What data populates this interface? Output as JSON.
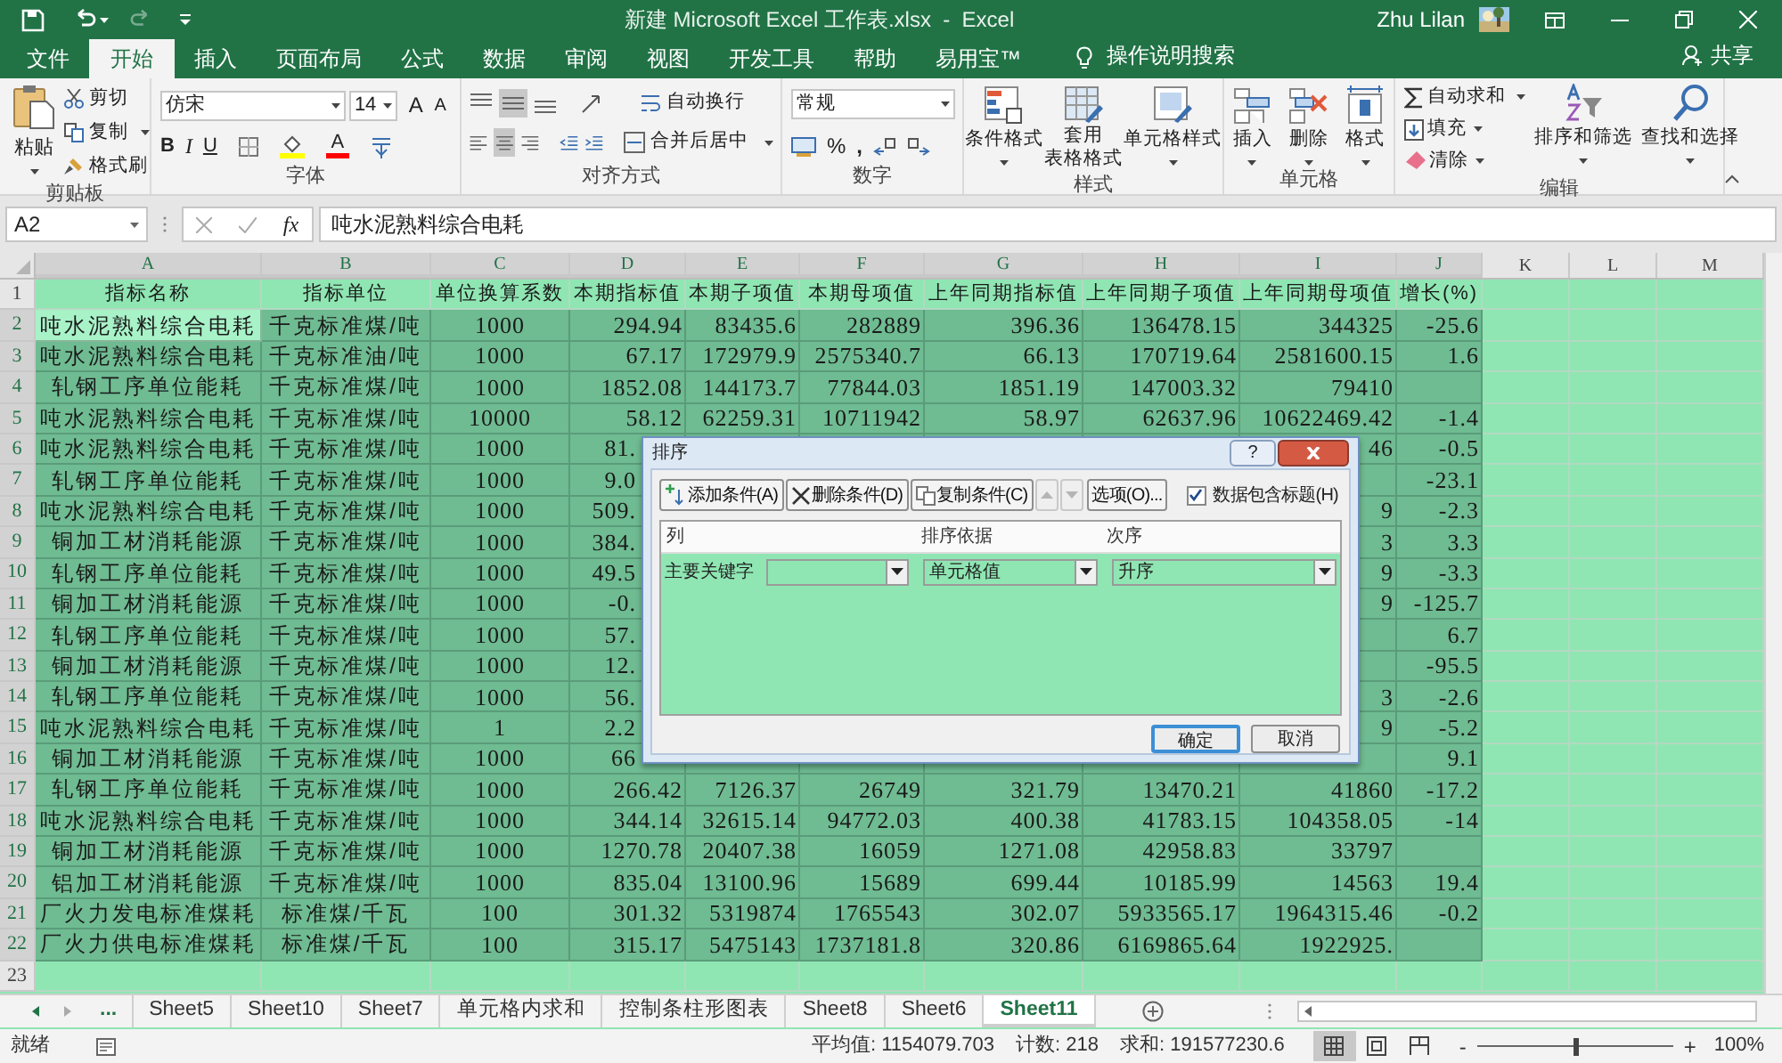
{
  "title_bar": {
    "title": "新建 Microsoft Excel 工作表.xlsx  -  Excel",
    "user": "Zhu Lilan"
  },
  "menu_tabs": [
    {
      "label": "文件",
      "selected": false
    },
    {
      "label": "开始",
      "selected": true
    },
    {
      "label": "插入",
      "selected": false
    },
    {
      "label": "页面布局",
      "selected": false
    },
    {
      "label": "公式",
      "selected": false
    },
    {
      "label": "数据",
      "selected": false
    },
    {
      "label": "审阅",
      "selected": false
    },
    {
      "label": "视图",
      "selected": false
    },
    {
      "label": "开发工具",
      "selected": false
    },
    {
      "label": "帮助",
      "selected": false
    },
    {
      "label": "易用宝™",
      "selected": false
    }
  ],
  "tell_me": "操作说明搜索",
  "share": "共享",
  "ribbon": {
    "clipboard": {
      "label": "剪贴板",
      "paste": "粘贴",
      "cut": "剪切",
      "copy": "复制",
      "format_painter": "格式刷"
    },
    "font": {
      "label": "字体",
      "font_name": "仿宋",
      "font_size": "14",
      "grow": "A",
      "shrink": "A",
      "bold": "B",
      "italic": "I",
      "underline": "U",
      "font_color": "A"
    },
    "alignment": {
      "label": "对齐方式",
      "wrap_text": "自动换行",
      "merge_center": "合并后居中"
    },
    "number": {
      "label": "数字",
      "format": "常规",
      "percent": "%",
      "comma": ","
    },
    "styles": {
      "label": "样式",
      "conditional": "条件格式",
      "table_format": [
        "套用",
        "表格格式"
      ],
      "cell_styles": "单元格样式"
    },
    "cells": {
      "label": "单元格",
      "insert": "插入",
      "delete": "删除",
      "format": "格式"
    },
    "editing": {
      "label": "编辑",
      "autosum": "自动求和",
      "fill": "填充",
      "clear": "清除",
      "sort_filter": "排序和筛选",
      "find_select": "查找和选择"
    }
  },
  "formula_bar": {
    "name_box": "A2",
    "fx": "fx",
    "content": "吨水泥熟料综合电耗"
  },
  "grid": {
    "columns": [
      {
        "label": "A",
        "selected": true
      },
      {
        "label": "B",
        "selected": true
      },
      {
        "label": "C",
        "selected": true
      },
      {
        "label": "D",
        "selected": true
      },
      {
        "label": "E",
        "selected": true
      },
      {
        "label": "F",
        "selected": true
      },
      {
        "label": "G",
        "selected": true
      },
      {
        "label": "H",
        "selected": true
      },
      {
        "label": "I",
        "selected": true
      },
      {
        "label": "J",
        "selected": true
      },
      {
        "label": "K",
        "selected": false
      },
      {
        "label": "L",
        "selected": false
      },
      {
        "label": "M",
        "selected": false
      }
    ],
    "rows": [
      {
        "number": "1",
        "selected": false,
        "active": false,
        "cells": {
          "A": "指标名称",
          "B": "指标单位",
          "C": "单位换算系数",
          "D": "本期指标值",
          "E": "本期子项值",
          "F": "本期母项值",
          "G": "上年同期指标值",
          "H": "上年同期子项值",
          "I": "上年同期母项值",
          "J": "增长(%)"
        }
      },
      {
        "number": "2",
        "selected": true,
        "active": true,
        "cells": {
          "A": "吨水泥熟料综合电耗",
          "B": "千克标准煤/吨",
          "C": "1000",
          "D": "294.94",
          "E": "83435.6",
          "F": "282889",
          "G": "396.36",
          "H": "136478.15",
          "I": "344325",
          "J": "-25.6"
        }
      },
      {
        "number": "3",
        "selected": true,
        "active": false,
        "cells": {
          "A": "吨水泥熟料综合电耗",
          "B": "千克标准油/吨",
          "C": "1000",
          "D": "67.17",
          "E": "172979.9",
          "F": "2575340.7",
          "G": "66.13",
          "H": "170719.64",
          "I": "2581600.15",
          "J": "1.6"
        }
      },
      {
        "number": "4",
        "selected": true,
        "active": false,
        "cells": {
          "A": "轧钢工序单位能耗",
          "B": "千克标准煤/吨",
          "C": "1000",
          "D": "1852.08",
          "E": "144173.7",
          "F": "77844.03",
          "G": "1851.19",
          "H": "147003.32",
          "I": "79410"
        }
      },
      {
        "number": "5",
        "selected": true,
        "active": false,
        "cells": {
          "A": "吨水泥熟料综合电耗",
          "B": "千克标准煤/吨",
          "C": "10000",
          "D": "58.12",
          "E": "62259.31",
          "F": "10711942",
          "G": "58.97",
          "H": "62637.96",
          "I": "10622469.42",
          "J": "-1.4"
        }
      },
      {
        "number": "6",
        "selected": true,
        "active": false,
        "cells": {
          "A": "吨水泥熟料综合电耗",
          "B": "千克标准煤/吨",
          "C": "1000",
          "D": "81.",
          "I": "46",
          "J": "-0.5"
        }
      },
      {
        "number": "7",
        "selected": true,
        "active": false,
        "cells": {
          "A": "轧钢工序单位能耗",
          "B": "千克标准煤/吨",
          "C": "1000",
          "D": "9.0",
          "J": "-23.1"
        }
      },
      {
        "number": "8",
        "selected": true,
        "active": false,
        "cells": {
          "A": "吨水泥熟料综合电耗",
          "B": "千克标准煤/吨",
          "C": "1000",
          "D": "509.",
          "I": "9",
          "J": "-2.3"
        }
      },
      {
        "number": "9",
        "selected": true,
        "active": false,
        "cells": {
          "A": "铜加工材消耗能源",
          "B": "千克标准煤/吨",
          "C": "1000",
          "D": "384.",
          "I": "3",
          "J": "3.3"
        }
      },
      {
        "number": "10",
        "selected": true,
        "active": false,
        "cells": {
          "A": "轧钢工序单位能耗",
          "B": "千克标准煤/吨",
          "C": "1000",
          "D": "49.5",
          "I": "9",
          "J": "-3.3"
        }
      },
      {
        "number": "11",
        "selected": true,
        "active": false,
        "cells": {
          "A": "铜加工材消耗能源",
          "B": "千克标准煤/吨",
          "C": "1000",
          "D": "-0.",
          "I": "9",
          "J": "-125.7"
        }
      },
      {
        "number": "12",
        "selected": true,
        "active": false,
        "cells": {
          "A": "轧钢工序单位能耗",
          "B": "千克标准煤/吨",
          "C": "1000",
          "D": "57.",
          "J": "6.7"
        }
      },
      {
        "number": "13",
        "selected": true,
        "active": false,
        "cells": {
          "A": "铜加工材消耗能源",
          "B": "千克标准煤/吨",
          "C": "1000",
          "D": "12.",
          "J": "-95.5"
        }
      },
      {
        "number": "14",
        "selected": true,
        "active": false,
        "cells": {
          "A": "轧钢工序单位能耗",
          "B": "千克标准煤/吨",
          "C": "1000",
          "D": "56.",
          "I": "3",
          "J": "-2.6"
        }
      },
      {
        "number": "15",
        "selected": true,
        "active": false,
        "cells": {
          "A": "吨水泥熟料综合电耗",
          "B": "千克标准煤/吨",
          "C": "1",
          "D": "2.2",
          "I": "9",
          "J": "-5.2"
        }
      },
      {
        "number": "16",
        "selected": true,
        "active": false,
        "cells": {
          "A": "铜加工材消耗能源",
          "B": "千克标准煤/吨",
          "C": "1000",
          "D": "66",
          "J": "9.1"
        }
      },
      {
        "number": "17",
        "selected": true,
        "active": false,
        "cells": {
          "A": "轧钢工序单位能耗",
          "B": "千克标准煤/吨",
          "C": "1000",
          "D": "266.42",
          "E": "7126.37",
          "F": "26749",
          "G": "321.79",
          "H": "13470.21",
          "I": "41860",
          "J": "-17.2"
        }
      },
      {
        "number": "18",
        "selected": true,
        "active": false,
        "cells": {
          "A": "吨水泥熟料综合电耗",
          "B": "千克标准煤/吨",
          "C": "1000",
          "D": "344.14",
          "E": "32615.14",
          "F": "94772.03",
          "G": "400.38",
          "H": "41783.15",
          "I": "104358.05",
          "J": "-14"
        }
      },
      {
        "number": "19",
        "selected": true,
        "active": false,
        "cells": {
          "A": "铜加工材消耗能源",
          "B": "千克标准煤/吨",
          "C": "1000",
          "D": "1270.78",
          "E": "20407.38",
          "F": "16059",
          "G": "1271.08",
          "H": "42958.83",
          "I": "33797"
        }
      },
      {
        "number": "20",
        "selected": true,
        "active": false,
        "cells": {
          "A": "铝加工材消耗能源",
          "B": "千克标准煤/吨",
          "C": "1000",
          "D": "835.04",
          "E": "13100.96",
          "F": "15689",
          "G": "699.44",
          "H": "10185.99",
          "I": "14563",
          "J": "19.4"
        }
      },
      {
        "number": "21",
        "selected": true,
        "active": false,
        "cells": {
          "A": "厂火力发电标准煤耗",
          "B": "标准煤/千瓦",
          "C": "100",
          "D": "301.32",
          "E": "5319874",
          "F": "1765543",
          "G": "302.07",
          "H": "5933565.17",
          "I": "1964315.46",
          "J": "-0.2"
        }
      },
      {
        "number": "22",
        "selected": true,
        "active": false,
        "cells": {
          "A": "厂火力供电标准煤耗",
          "B": "标准煤/千瓦",
          "C": "100",
          "D": "315.17",
          "E": "5475143",
          "F": "1737181.8",
          "G": "320.86",
          "H": "6169865.64",
          "I": "1922925."
        }
      },
      {
        "number": "23",
        "selected": false,
        "active": false
      }
    ]
  },
  "sort_dialog": {
    "title": "排序",
    "help": "?",
    "toolbar": [
      {
        "kind": "add",
        "label": "添加条件(A)",
        "disabled": false
      },
      {
        "kind": "delete",
        "label": "删除条件(D)",
        "disabled": false
      },
      {
        "kind": "copy",
        "label": "复制条件(C)",
        "disabled": false
      },
      {
        "kind": "up",
        "disabled": true
      },
      {
        "kind": "down",
        "disabled": true
      },
      {
        "kind": "options",
        "label": "选项(O)...",
        "disabled": false
      }
    ],
    "has_headers": {
      "label": "数据包含标题(H)",
      "checked": true
    },
    "columns": [
      "列",
      "排序依据",
      "次序"
    ],
    "levels": [
      {
        "label": "主要关键字",
        "sort_on": "单元格值",
        "order": "升序"
      }
    ],
    "buttons": [
      {
        "label": "确定",
        "default": true
      },
      {
        "label": "取消",
        "default": false
      }
    ]
  },
  "sheet_tabs": {
    "more": "...",
    "tabs": [
      {
        "label": "Sheet5",
        "selected": false
      },
      {
        "label": "Sheet10",
        "selected": false
      },
      {
        "label": "Sheet7",
        "selected": false
      },
      {
        "label": "单元格内求和",
        "selected": false
      },
      {
        "label": "控制条柱形图表",
        "selected": false
      },
      {
        "label": "Sheet8",
        "selected": false
      },
      {
        "label": "Sheet6",
        "selected": false
      },
      {
        "label": "Sheet11",
        "selected": true
      }
    ]
  },
  "status_bar": {
    "ready": "就绪",
    "average": "平均值: 1154079.703",
    "count": "计数: 218",
    "sum": "求和: 191577230.6",
    "views": [
      {
        "kind": "normal",
        "selected": true
      },
      {
        "kind": "page_layout",
        "selected": false
      },
      {
        "kind": "page_break",
        "selected": false
      }
    ],
    "zoom": {
      "out": "-",
      "in": "+",
      "level": 0.5,
      "reading": "100%"
    }
  }
}
